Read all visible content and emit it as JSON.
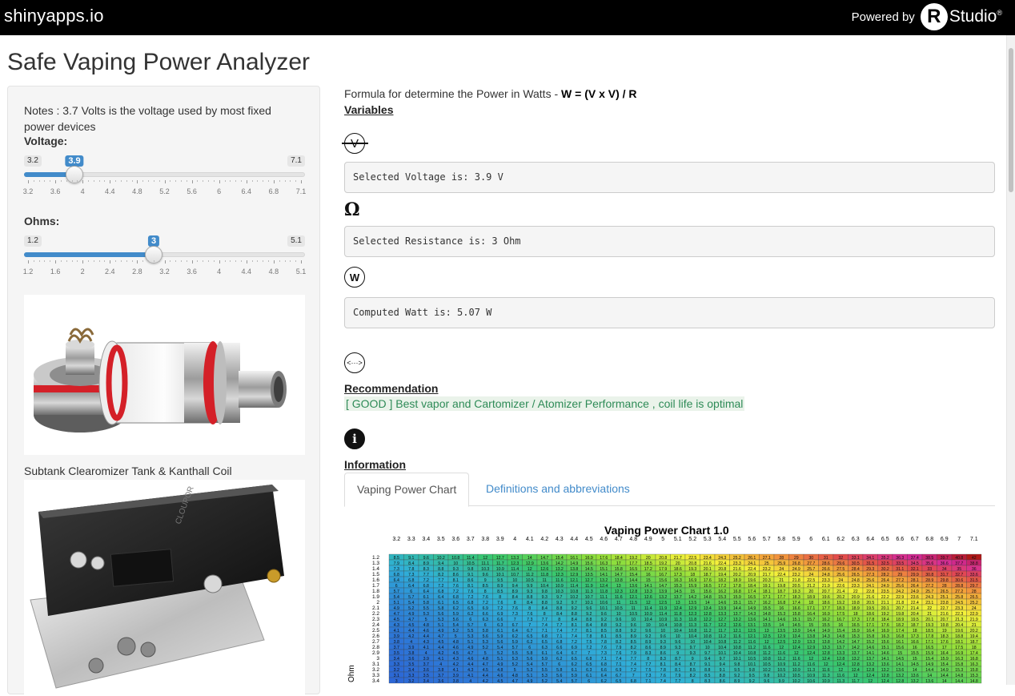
{
  "topbar": {
    "brand": "shinyapps.io",
    "powered_by": "Powered by",
    "r_logo": "R",
    "rstudio": "Studio",
    "reg": "®"
  },
  "app_title": "Safe Vaping Power Analyzer",
  "sidebar": {
    "notes": "Notes : 3.7 Volts is the voltage used by most fixed power devices",
    "voltage": {
      "label": "Voltage:",
      "min_label": "3.2",
      "max_label": "7.1",
      "value_label": "3.9",
      "value": 3.9,
      "min": 3.2,
      "max": 7.1,
      "ticks": [
        "3.2",
        "3.6",
        "4",
        "4.4",
        "4.8",
        "5.2",
        "5.6",
        "6",
        "6.4",
        "6.8",
        "7.1"
      ]
    },
    "ohms": {
      "label": "Ohms:",
      "min_label": "1.2",
      "max_label": "5.1",
      "value_label": "3",
      "value": 3,
      "min": 1.2,
      "max": 5.1,
      "ticks": [
        "1.2",
        "1.6",
        "2",
        "2.4",
        "2.8",
        "3.2",
        "3.6",
        "4",
        "4.4",
        "4.8",
        "5.1"
      ]
    },
    "image1_caption": "Subtank Clearomizer Tank & Kanthall Coil"
  },
  "main": {
    "formula_prefix": "Formula for determine the Power in Watts - ",
    "formula": "W = (V x V) / R",
    "variables_heading": "Variables",
    "voltage_icon": "V",
    "voltage_output": "Selected Voltage is: 3.9 V",
    "ohm_icon": "Ω",
    "resistance_output": "Selected Resistance is: 3 Ohm",
    "watt_icon": "W",
    "watt_output": "Computed Watt is: 5.07 W",
    "recommendation_icon": "<···>",
    "recommendation_heading": "Recommendation",
    "recommendation": "[ GOOD ] Best vapor and Cartomizer / Atomizer Performance , coil life is optimal",
    "info_icon": "i",
    "information_heading": "Information",
    "tabs": [
      {
        "label": "Vaping Power Chart",
        "active": true
      },
      {
        "label": "Definitions and abbreviations",
        "active": false
      }
    ]
  },
  "chart_data": {
    "type": "heatmap",
    "title": "Vaping Power Chart 1.0",
    "ylabel": "Ohm",
    "x_label_values": [
      "3.2",
      "3.3",
      "3.4",
      "3.5",
      "3.6",
      "3.7",
      "3.8",
      "3.9",
      "4",
      "4.1",
      "4.2",
      "4.3",
      "4.4",
      "4.5",
      "4.6",
      "4.7",
      "4.8",
      "4.9",
      "5",
      "5.1",
      "5.2",
      "5.3",
      "5.4",
      "5.5",
      "5.6",
      "5.7",
      "5.8",
      "5.9",
      "6",
      "6.1",
      "6.2",
      "6.3",
      "6.4",
      "6.5",
      "6.6",
      "6.7",
      "6.8",
      "6.9",
      "7",
      "7.1"
    ],
    "x_column_values": [
      3.2,
      3.3,
      3.4,
      3.5,
      3.6,
      3.7,
      3.8,
      3.9,
      4.0,
      4.1,
      4.2,
      4.3,
      4.4,
      4.5,
      4.6,
      4.7,
      4.8,
      4.9,
      5.0,
      5.1,
      5.2,
      5.3,
      5.4,
      5.5,
      5.6,
      5.7,
      5.8,
      5.9,
      6.0,
      6.1,
      6.2,
      6.3,
      6.4,
      6.5,
      6.6,
      6.7,
      6.8,
      6.9,
      7.0,
      7.1
    ],
    "y_label_values": [
      "1.2",
      "1.3",
      "1.4",
      "1.5",
      "1.6",
      "1.7",
      "1.8",
      "1.9",
      "2",
      "2.1",
      "2.2",
      "2.3",
      "2.4",
      "2.5",
      "2.6",
      "2.7",
      "2.8",
      "2.9",
      "3",
      "3.1",
      "3.2",
      "3.3",
      "3.4"
    ],
    "y_row_values": [
      1.2,
      1.3,
      1.4,
      1.5,
      1.6,
      1.7,
      1.8,
      1.9,
      2.0,
      2.1,
      2.2,
      2.3,
      2.4,
      2.5,
      2.6,
      2.7,
      2.8,
      2.9,
      3.0,
      3.1,
      3.2,
      3.3,
      3.4
    ],
    "cell_value": "watts = x*x / y",
    "color_scale": [
      "#2c5fd6",
      "#2fb0d8",
      "#39c86c",
      "#93e03a",
      "#f4f23a",
      "#f4a23a",
      "#e34b4b",
      "#d62a9c",
      "#b01818"
    ]
  }
}
